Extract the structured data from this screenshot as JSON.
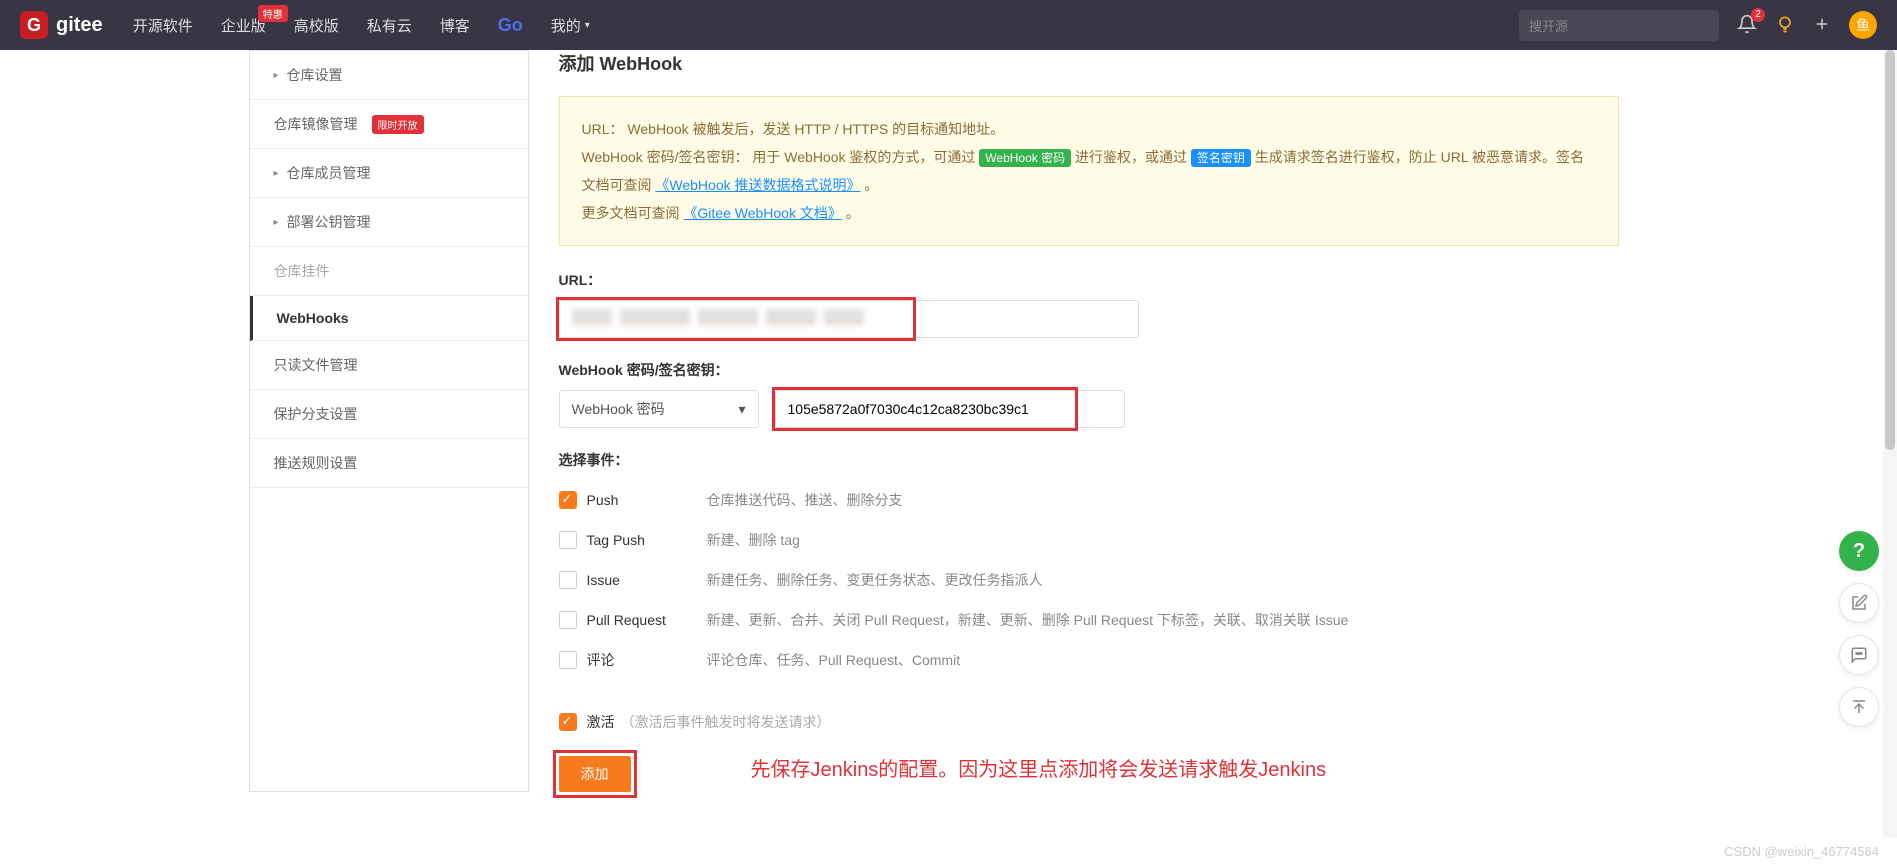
{
  "header": {
    "logo_text": "gitee",
    "nav": {
      "open_source": "开源软件",
      "enterprise": "企业版",
      "enterprise_badge": "特惠",
      "campus": "高校版",
      "private_cloud": "私有云",
      "blog": "博客",
      "go": "Go",
      "my": "我的"
    },
    "search_placeholder": "搜开源",
    "notifications_count": "2",
    "avatar_text": "鱼"
  },
  "sidebar": {
    "items": [
      {
        "label": "仓库设置",
        "has_caret": true
      },
      {
        "label": "仓库镜像管理",
        "badge": "限时开放"
      },
      {
        "label": "仓库成员管理",
        "has_caret": true
      },
      {
        "label": "部署公钥管理",
        "has_caret": true
      },
      {
        "label": "仓库挂件",
        "disabled": true
      },
      {
        "label": "WebHooks",
        "active": true
      },
      {
        "label": "只读文件管理"
      },
      {
        "label": "保护分支设置"
      },
      {
        "label": "推送规则设置"
      }
    ]
  },
  "content": {
    "title": "添加 WebHook",
    "info": {
      "url_tip_label": "URL：",
      "url_tip": "WebHook 被触发后，发送 HTTP / HTTPS 的目标通知地址。",
      "pwd_tip_label": "WebHook 密码/签名密钥：",
      "pwd_tip_1": "用于 WebHook 鉴权的方式，可通过",
      "tag_green": "WebHook 密码",
      "pwd_tip_2": "进行鉴权，或通过",
      "tag_blue": "签名密钥",
      "pwd_tip_3": "生成请求签名进行鉴权，防止 URL 被恶意请求。签名文档可查阅",
      "doc_link_1": "《WebHook 推送数据格式说明》",
      "period_1": "。",
      "more_docs": "更多文档可查阅",
      "doc_link_2": "《Gitee WebHook 文档》",
      "period_2": "。"
    },
    "url_label": "URL：",
    "secret_label": "WebHook 密码/签名密钥：",
    "secret_select": "WebHook 密码",
    "secret_value": "105e5872a0f7030c4c12ca8230bc39c1",
    "events_label": "选择事件：",
    "events": [
      {
        "name": "Push",
        "desc": "仓库推送代码、推送、删除分支",
        "checked": true
      },
      {
        "name": "Tag Push",
        "desc": "新建、删除 tag",
        "checked": false
      },
      {
        "name": "Issue",
        "desc": "新建任务、删除任务、变更任务状态、更改任务指派人",
        "checked": false
      },
      {
        "name": "Pull Request",
        "desc": "新建、更新、合并、关闭 Pull Request，新建、更新、删除 Pull Request 下标签，关联、取消关联 Issue",
        "checked": false
      },
      {
        "name": "评论",
        "desc": "评论仓库、任务、Pull Request、Commit",
        "checked": false
      }
    ],
    "activate_label": "激活",
    "activate_hint": "（激活后事件触发时将发送请求）",
    "submit": "添加",
    "red_note": "先保存Jenkins的配置。因为这里点添加将会发送请求触发Jenkins"
  },
  "watermark": "CSDN @weixin_46774564"
}
